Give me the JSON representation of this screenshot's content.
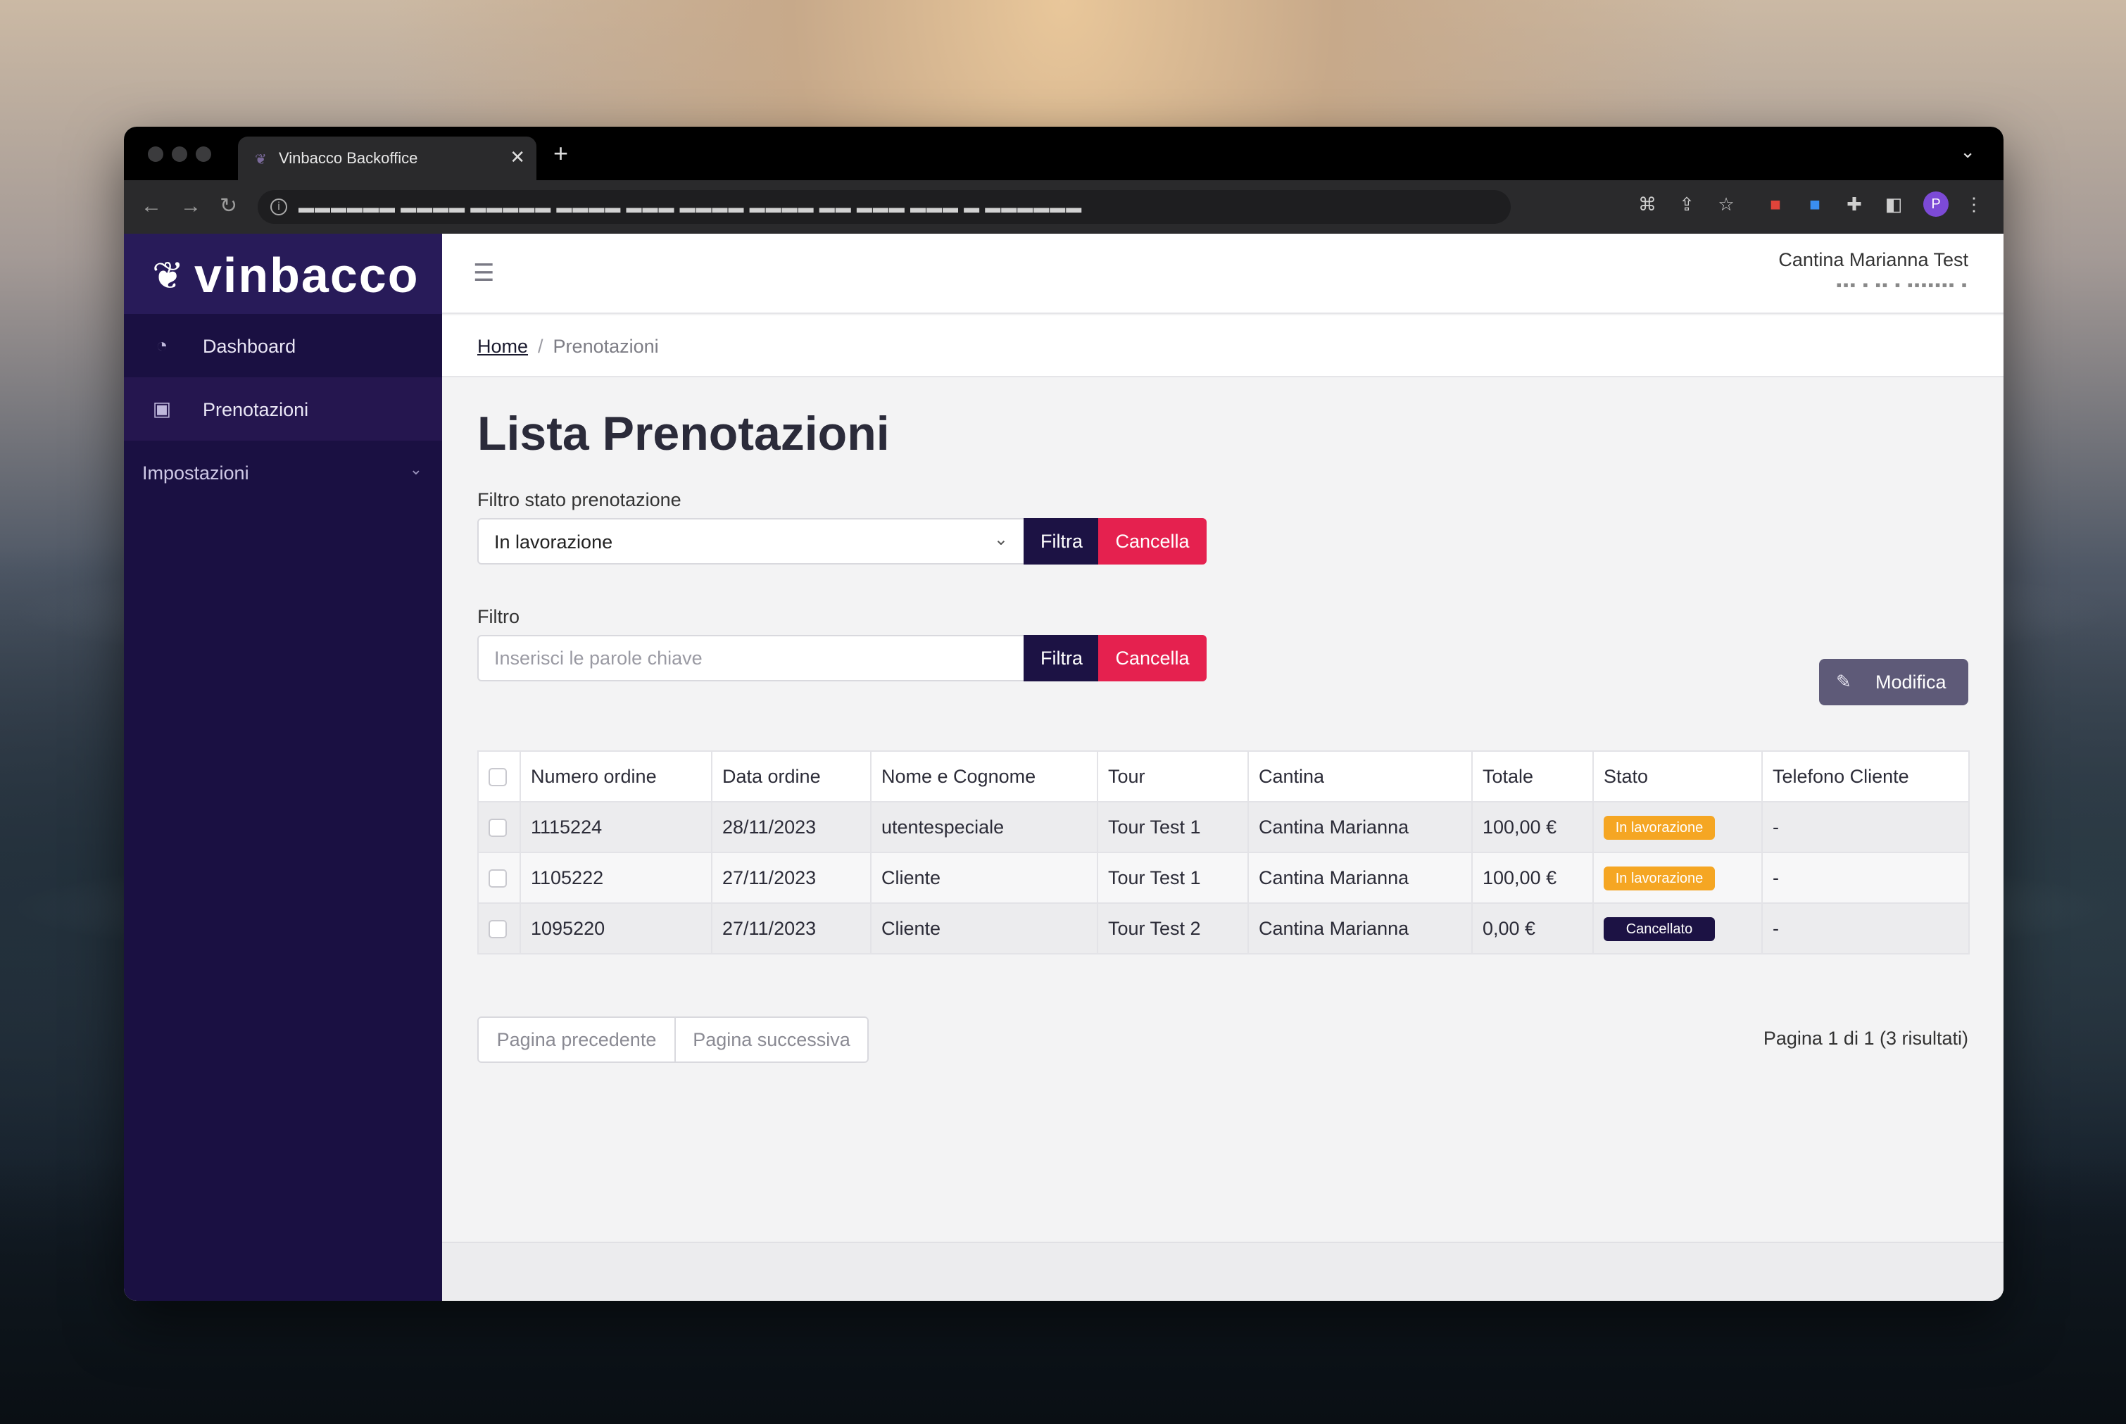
{
  "browser": {
    "tab_title": "Vinbacco Backoffice",
    "tab_close": "✕",
    "new_tab": "+",
    "url": "▬▬▬▬▬▬ ▬▬▬▬ ▬▬▬▬▬ ▬▬▬▬ ▬▬▬ ▬▬▬▬ ▬▬▬▬ ▬▬ ▬▬▬ ▬▬▬ ▬ ▬▬▬▬▬▬"
  },
  "brand": {
    "name": "vinbacco"
  },
  "sidebar": {
    "items": [
      {
        "label": "Dashboard",
        "icon": "dashboard-icon"
      },
      {
        "label": "Prenotazioni",
        "icon": "bookings-icon",
        "active": true
      }
    ],
    "groups": [
      {
        "label": "Impostazioni"
      }
    ]
  },
  "header": {
    "user_name": "Cantina Marianna Test",
    "user_sub": "▪▪▪ ▪ ▪▪ ▪ ▪▪▪▪▪▪▪ ▪"
  },
  "breadcrumb": {
    "home": "Home",
    "separator": "/",
    "current": "Prenotazioni"
  },
  "page": {
    "title": "Lista Prenotazioni"
  },
  "filters": {
    "status": {
      "label": "Filtro stato prenotazione",
      "selected": "In lavorazione",
      "filter_button": "Filtra",
      "cancel_button": "Cancella"
    },
    "keyword": {
      "label": "Filtro",
      "placeholder": "Inserisci le parole chiave",
      "filter_button": "Filtra",
      "cancel_button": "Cancella"
    }
  },
  "actions": {
    "edit_button": "Modifica"
  },
  "table": {
    "columns": [
      "Numero ordine",
      "Data ordine",
      "Nome e Cognome",
      "Tour",
      "Cantina",
      "Totale",
      "Stato",
      "Telefono Cliente"
    ],
    "rows": [
      {
        "order": "1115224",
        "date": "28/11/2023",
        "name": "utentespeciale",
        "tour": "Tour Test 1",
        "winery": "Cantina Marianna",
        "total": "100,00 €",
        "status": "In lavorazione",
        "status_color": "#f5a623",
        "phone": "-"
      },
      {
        "order": "1105222",
        "date": "27/11/2023",
        "name": "Cliente",
        "tour": "Tour Test 1",
        "winery": "Cantina Marianna",
        "total": "100,00 €",
        "status": "In lavorazione",
        "status_color": "#f5a623",
        "phone": "-"
      },
      {
        "order": "1095220",
        "date": "27/11/2023",
        "name": "Cliente",
        "tour": "Tour Test 2",
        "winery": "Cantina Marianna",
        "total": "0,00 €",
        "status": "Cancellato",
        "status_color": "#1c1244",
        "phone": "-"
      }
    ]
  },
  "pagination": {
    "prev": "Pagina precedente",
    "next": "Pagina successiva",
    "info": "Pagina 1 di 1 (3 risultati)"
  },
  "colors": {
    "sidebar": "#1a1042",
    "brand": "#281b59",
    "primary": "#1c1244",
    "danger": "#e5214f",
    "warning": "#f5a623"
  }
}
